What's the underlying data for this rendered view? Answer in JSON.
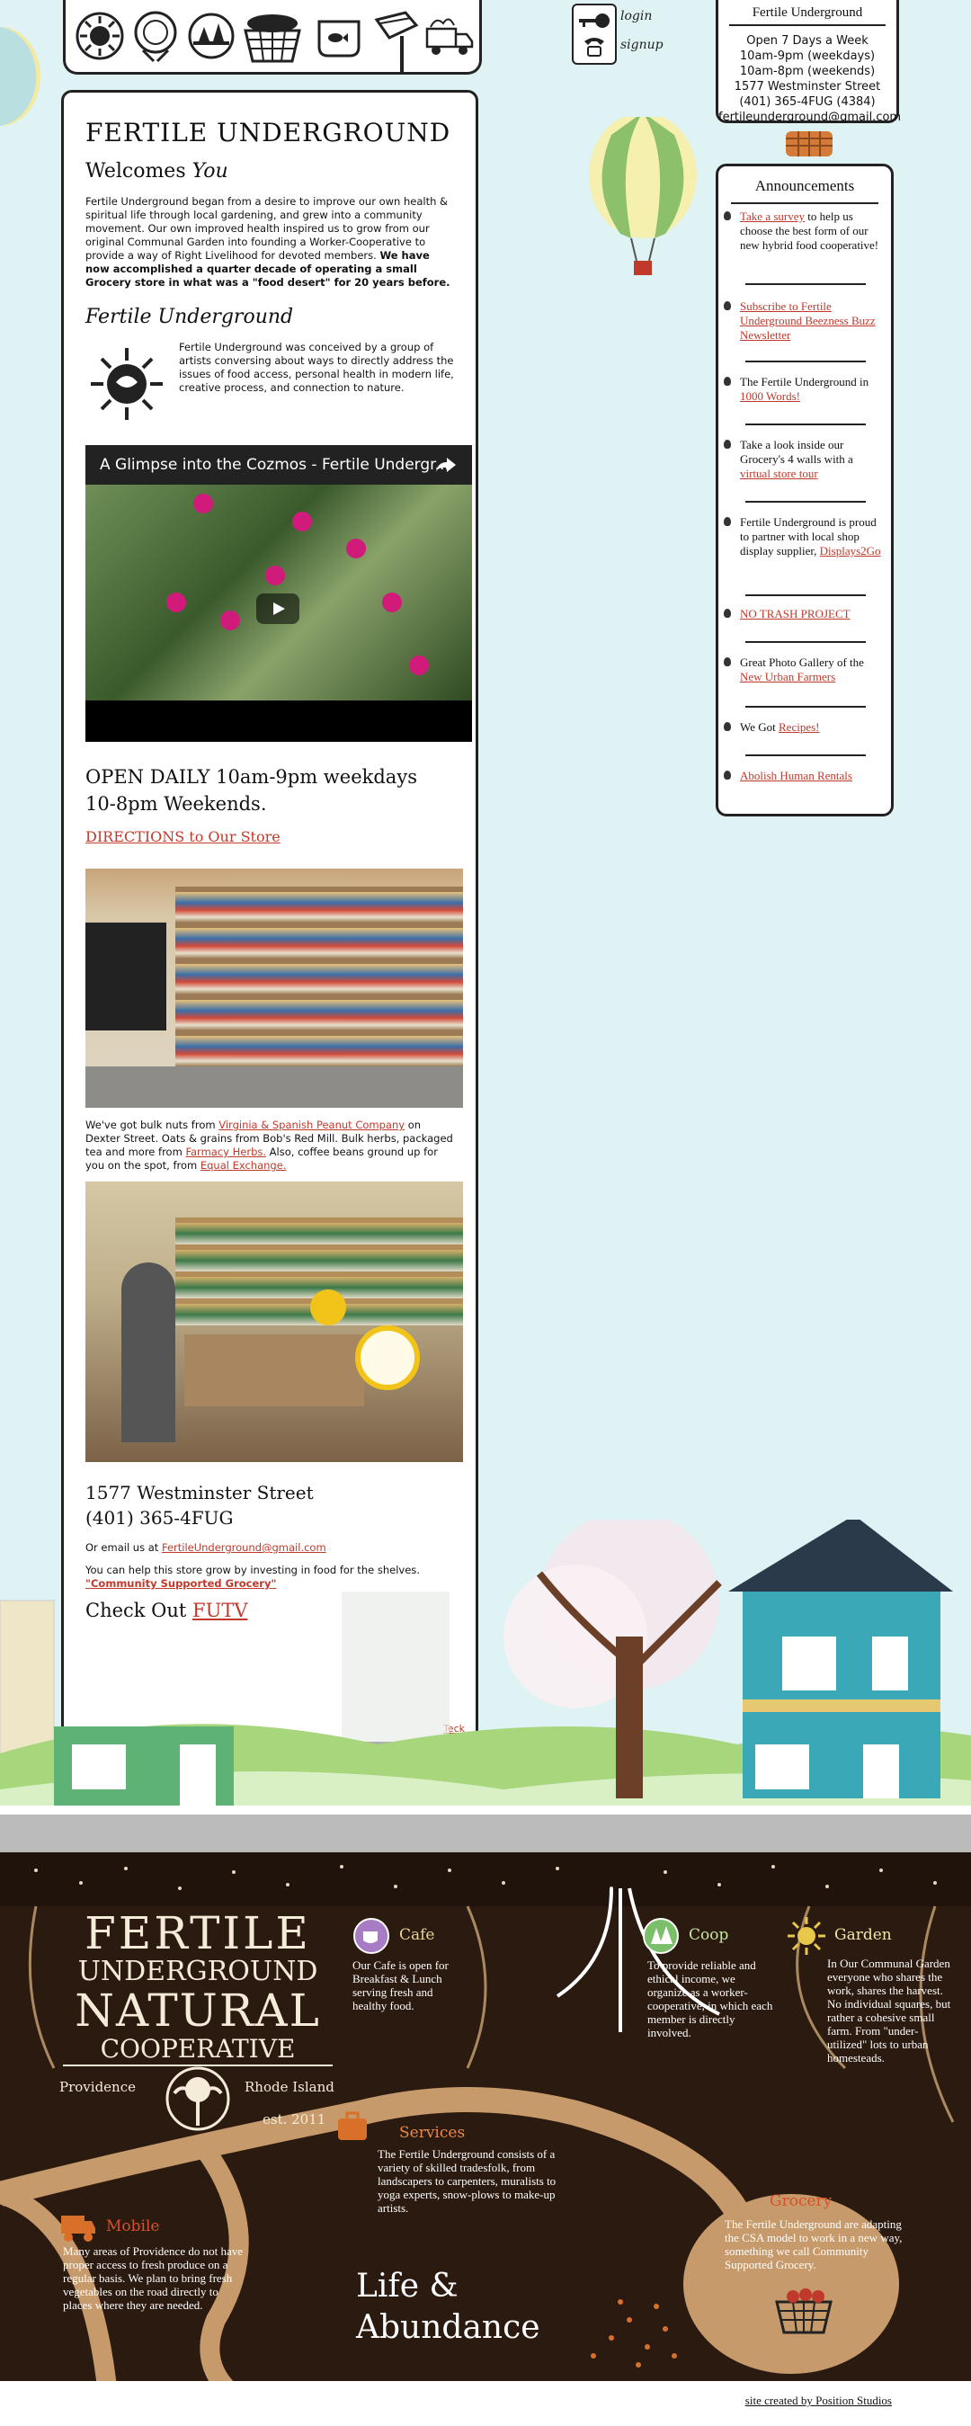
{
  "icons": {
    "top": [
      "sunflower-icon",
      "plate-icon",
      "coop-icon",
      "basket-icon",
      "aquarium-icon",
      "watering-can-icon",
      "truck-icon"
    ],
    "key": "key-icon",
    "phone": "phone-icon"
  },
  "auth": {
    "login": "login",
    "signup": "signup"
  },
  "hours": {
    "title": "Fertile Underground",
    "line1": "Open 7 Days a Week",
    "line2": "10am-9pm (weekdays)",
    "line3": "10am-8pm (weekends)",
    "line4": "1577 Westminster Street",
    "line5": "(401) 365-4FUG (4384)",
    "line6": "fertileunderground@gmail.com"
  },
  "main": {
    "title": "FERTILE UNDERGROUND",
    "welcome_prefix": "Welcomes ",
    "welcome_you": "You",
    "intro": "Fertile Underground began from a desire to improve our own health & spiritual life through local gardening, and grew into a community movement. Our own improved health inspired us to grow from our original Communal Garden into founding a Worker-Cooperative to provide a way of Right Livelihood for devoted members.",
    "intro_bold": "We have now accomplished a quarter decade of operating a small Grocery store in what was a \"food desert\" for 20 years before.",
    "subtitle": "Fertile Underground",
    "conceived": "Fertile Underground was conceived by a group of artists conversing about ways to directly address the issues of food access, personal health in modern life, creative process, and connection to nature.",
    "video_title": "A Glimpse into the Cozmos - Fertile Undergr...",
    "open_line1": "OPEN DAILY 10am-9pm weekdays",
    "open_line2": "10-8pm Weekends.",
    "directions": "DIRECTIONS to Our Store",
    "bulk_1": "We've got bulk nuts from ",
    "bulk_link1": "Virginia & Spanish Peanut Company",
    "bulk_2": " on Dexter Street. Oats & grains from Bob's Red Mill. Bulk herbs, packaged tea and more from ",
    "bulk_link2": "Farmacy Herbs.",
    "bulk_3": " Also, coffee beans ground up for you on the spot, from ",
    "bulk_link3": "Equal Exchange.",
    "address": "1577 Westminster Street",
    "phone": "(401) 365-4FUG",
    "email_prefix": "Or email us at ",
    "email": "FertileUnderground@gmail.com",
    "invest": "You can help this store grow by investing in food for the shelves.",
    "csg": "\"Community Supported Grocery\"",
    "checkout_prefix": "Check Out ",
    "futv": "FUTV",
    "teck": "Teck"
  },
  "announcements": {
    "title": "Announcements",
    "items": [
      {
        "link": "Take a survey",
        "text": " to help us choose the best form of our new hybrid food cooperative!"
      },
      {
        "link": "Subscribe to Fertile Underground Beezness Buzz Newsletter",
        "text": ""
      },
      {
        "pre": "The Fertile Underground in ",
        "link": "1000 Words!"
      },
      {
        "pre": "Take a look inside our Grocery's 4 walls with a ",
        "link": "virtual store tour"
      },
      {
        "pre": "Fertile Underground is proud to partner with local shop display supplier, ",
        "link": "Displays2Go"
      },
      {
        "link": "NO TRASH PROJECT"
      },
      {
        "pre": "Great Photo Gallery of the ",
        "link": "New Urban Farmers"
      },
      {
        "pre": "We Got ",
        "link": "Recipes!"
      },
      {
        "link": "Abolish Human Rentals"
      }
    ]
  },
  "underground": {
    "logo_line1": "FERTILE",
    "logo_line2": "UNDERGROUND",
    "logo_line3": "NATURAL",
    "logo_line4": "COOPERATIVE",
    "city": "Providence",
    "state": "Rhode Island",
    "est": "est. 2011",
    "cafe_title": "Cafe",
    "cafe_text": "Our Cafe is open for Breakfast & Lunch serving fresh and healthy food.",
    "coop_title": "Coop",
    "coop_text": "To provide reliable and ethical income, we organize as a worker-cooperative, in which each member is directly involved.",
    "garden_title": "Garden",
    "garden_text": "In Our Communal Garden everyone who shares the work, shares the harvest. No individual squares, but rather a cohesive small farm. From \"under-utilized\" lots to urban homesteads.",
    "services_title": "Services",
    "services_text": "The Fertile Underground consists of a variety of skilled tradesfolk, from landscapers to carpenters, muralists to yoga experts, snow-plows to make-up artists.",
    "grocery_title": "Grocery",
    "grocery_text": "The Fertile Underground are adapting the CSA model to work in a new way, something we call Community Supported Grocery.",
    "mobile_title": "Mobile",
    "mobile_text": "Many areas of Providence do not have proper access to fresh produce on a regular basis. We plan to bring fresh vegetables on the road directly to places where they are needed.",
    "life1": "Life &",
    "life2": "Abundance"
  },
  "footer": {
    "credit": "site created by Position Studios"
  },
  "colors": {
    "link": "#c0392b",
    "sky": "#dff2f4",
    "soil": "#2b1a10",
    "teal_house": "#3ba8b8"
  }
}
